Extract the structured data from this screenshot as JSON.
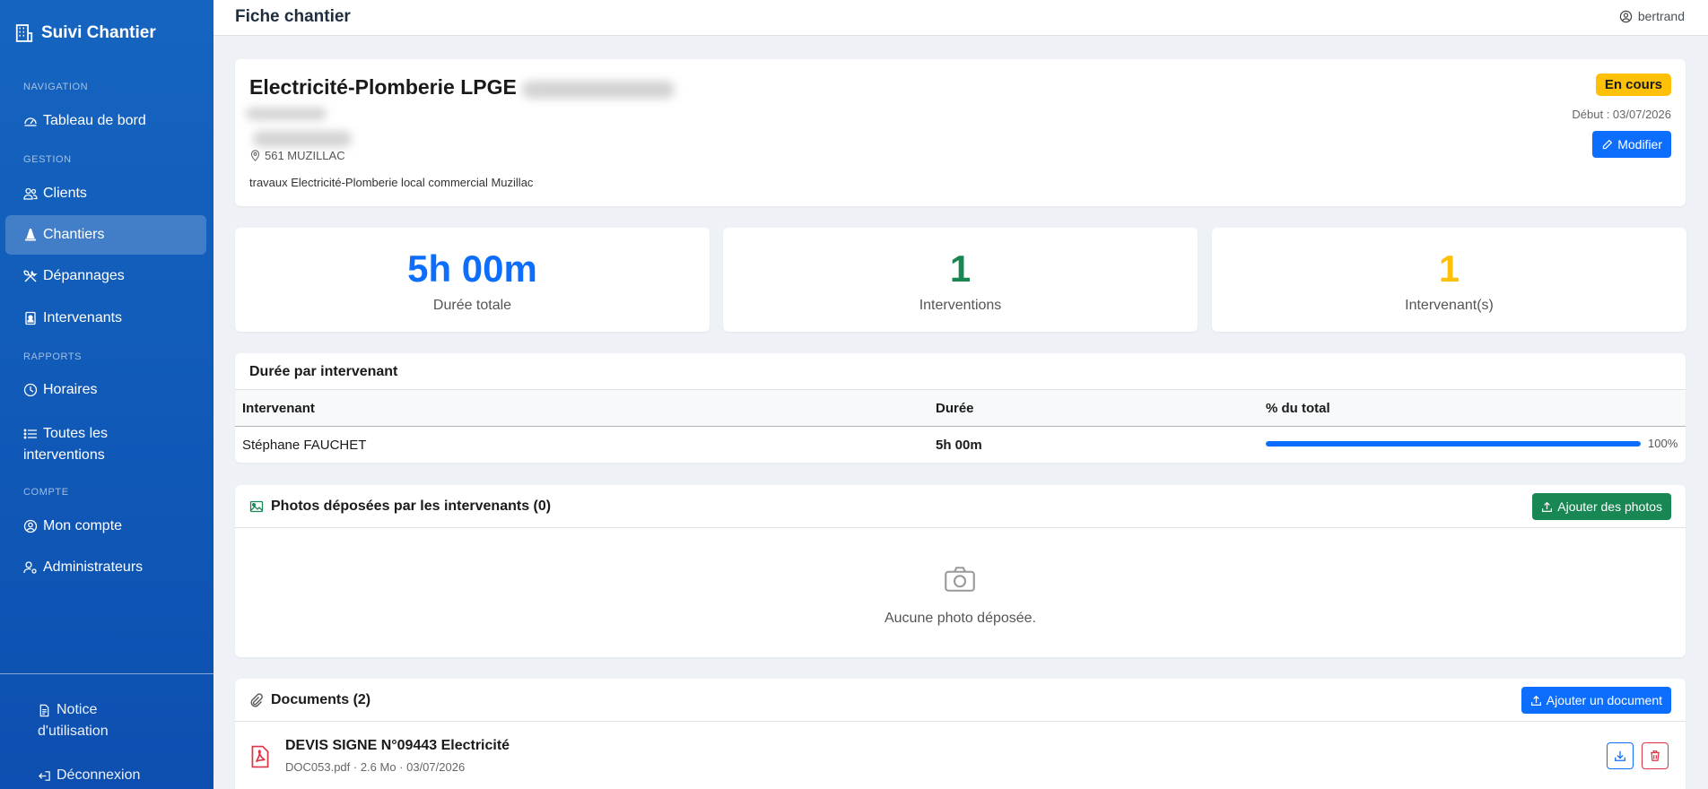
{
  "app": {
    "name": "Suivi Chantier"
  },
  "sidebar": {
    "sections": {
      "navigation": "NAVIGATION",
      "gestion": "GESTION",
      "rapports": "RAPPORTS",
      "compte": "COMPTE"
    },
    "items": {
      "dashboard": "Tableau de bord",
      "clients": "Clients",
      "chantiers": "Chantiers",
      "depannages": "Dépannages",
      "intervenants": "Intervenants",
      "horaires": "Horaires",
      "interventions_l1": "Toutes les",
      "interventions_l2": "interventions",
      "mon_compte": "Mon compte",
      "admins": "Administrateurs"
    },
    "footer": {
      "notice_l1": "Notice",
      "notice_l2": "d'utilisation",
      "logout": "Déconnexion"
    }
  },
  "topbar": {
    "title": "Fiche chantier",
    "user": "bertrand"
  },
  "chantier": {
    "name": "Electricité-Plomberie LPGE",
    "address": "561 MUZILLAC",
    "description": "travaux Electricité-Plomberie local commercial Muzillac",
    "status": "En cours",
    "start": "Début : 03/07/2026",
    "edit_label": "Modifier"
  },
  "stats": {
    "duration": {
      "value": "5h 00m",
      "label": "Durée totale",
      "color": "#0d6efd"
    },
    "interventions": {
      "value": "1",
      "label": "Interventions",
      "color": "#198754"
    },
    "intervenants": {
      "value": "1",
      "label": "Intervenant(s)",
      "color": "#ffc107"
    }
  },
  "duration_table": {
    "title": "Durée par intervenant",
    "headers": {
      "intervenant": "Intervenant",
      "duree": "Durée",
      "pct": "% du total"
    },
    "rows": [
      {
        "name": "Stéphane FAUCHET",
        "duration": "5h 00m",
        "percent_label": "100%",
        "percent": 100
      }
    ]
  },
  "photos": {
    "title": "Photos déposées par les intervenants (0)",
    "add_label": "Ajouter des photos",
    "empty": "Aucune photo déposée."
  },
  "documents": {
    "title": "Documents (2)",
    "add_label": "Ajouter un document",
    "items": [
      {
        "name": "DEVIS SIGNE N°09443 Electricité",
        "meta": "DOC053.pdf · 2.6 Mo · 03/07/2026"
      }
    ]
  }
}
